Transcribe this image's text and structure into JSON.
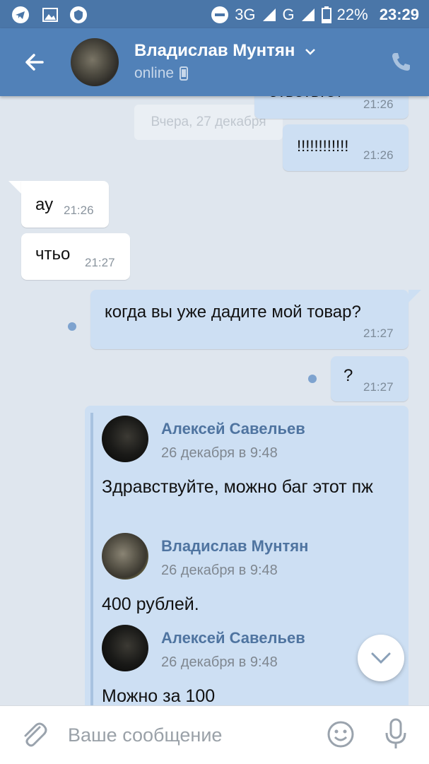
{
  "status_bar": {
    "network": "3G",
    "network2": "G",
    "battery": "22%",
    "time": "23:29"
  },
  "header": {
    "name": "Владислав Мунтян",
    "status": "online"
  },
  "chat": {
    "date_pill": "Вчера, 27 декабря",
    "messages": [
      {
        "text": "ответьте\\",
        "time": "21:26",
        "dir": "out"
      },
      {
        "text": "!!!!!!!!!!!!",
        "time": "21:26",
        "dir": "out"
      },
      {
        "text": "ау",
        "time": "21:26",
        "dir": "in"
      },
      {
        "text": "чтьо",
        "time": "21:27",
        "dir": "in"
      },
      {
        "text": "когда вы уже дадите мой товар?",
        "time": "21:27",
        "dir": "out"
      },
      {
        "text": "?",
        "time": "21:27",
        "dir": "out"
      }
    ],
    "forwarded": [
      {
        "author": "Алексей Савельев",
        "date": "26 декабря в 9:48",
        "text": "Здравствуйте, можно баг этот пж"
      },
      {
        "author": "Владислав Мунтян",
        "date": "26 декабря в 9:48",
        "text": "400 рублей."
      },
      {
        "author": "Алексей Савельев",
        "date": "26 декабря в 9:48",
        "text": "Можно за 100"
      }
    ]
  },
  "input": {
    "placeholder": "Ваше сообщение"
  }
}
